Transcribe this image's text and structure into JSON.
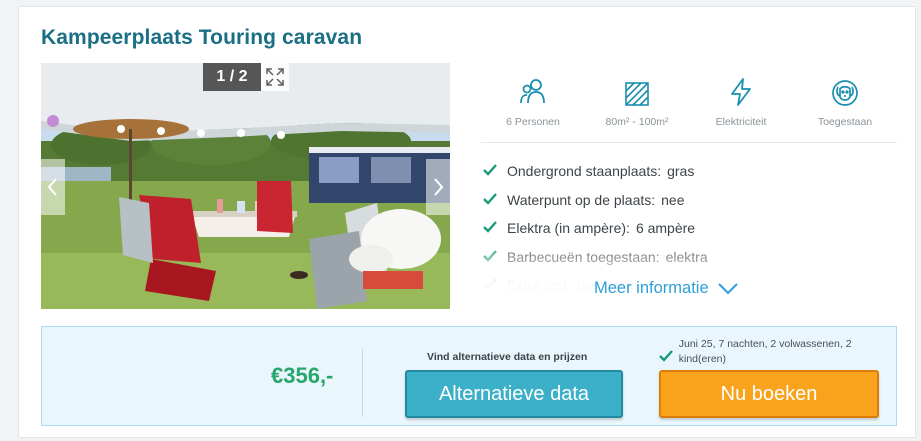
{
  "listing": {
    "title": "Kampeerplaats Touring caravan"
  },
  "gallery": {
    "counter": "1 / 2"
  },
  "features": [
    {
      "icon": "persons-icon",
      "label": "6 Personen"
    },
    {
      "icon": "area-icon",
      "label": "80m² - 100m²"
    },
    {
      "icon": "electricity-icon",
      "label": "Elektriciteit"
    },
    {
      "icon": "dog-icon",
      "label": "Toegestaan"
    }
  ],
  "specs": [
    {
      "key": "Ondergrond staanplaats:",
      "value": "gras"
    },
    {
      "key": "Waterpunt op de plaats:",
      "value": "nee"
    },
    {
      "key": "Elektra (in ampère):",
      "value": "6 ampère"
    },
    {
      "key": "Barbecueën toegestaan:",
      "value": "elektra"
    },
    {
      "key": "Extra tent:",
      "value": "toegestaan"
    }
  ],
  "more_info": "Meer informatie",
  "booking": {
    "price": "€356,-",
    "alt_caption": "Vind alternatieve data en prijzen",
    "alt_button": "Alternatieve data",
    "book_button": "Nu boeken",
    "summary": "Juni 25, 7 nachten, 2 volwassenen, 2 kind(eren)"
  },
  "colors": {
    "title": "#1a6f84",
    "accent_teal": "#3bb0c8",
    "accent_orange": "#f9a21c",
    "price_green": "#28a76c",
    "check_green": "#1a9a7a",
    "link_blue": "#2f9fd8",
    "icon_teal": "#1a8fb0"
  }
}
